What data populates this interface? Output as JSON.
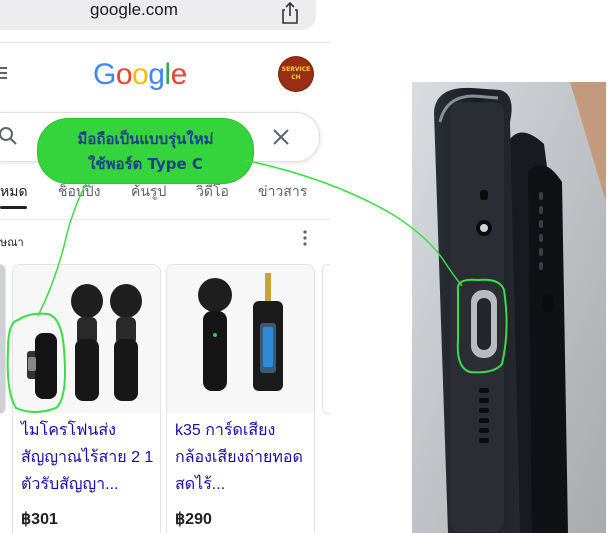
{
  "browser": {
    "url": "google.com",
    "share_icon": "share-icon"
  },
  "google": {
    "logo_letters": [
      {
        "char": "G",
        "color": "#4285F4"
      },
      {
        "char": "o",
        "color": "#EA4335"
      },
      {
        "char": "o",
        "color": "#FBBC05"
      },
      {
        "char": "g",
        "color": "#4285F4"
      },
      {
        "char": "l",
        "color": "#34A853"
      },
      {
        "char": "e",
        "color": "#EA4335"
      }
    ],
    "avatar_line1": "SERVICE",
    "avatar_line2": "CH",
    "menu_icon": "hamburger-icon",
    "search_icon": "search-icon",
    "clear_icon": "close-icon"
  },
  "tabs": [
    {
      "label": "หมด",
      "active": true
    },
    {
      "label": "ช็อปปิ้ง",
      "active": false
    },
    {
      "label": "ค้นรูป",
      "active": false
    },
    {
      "label": "วิดีโอ",
      "active": false
    },
    {
      "label": "ข่าวสาร",
      "active": false
    }
  ],
  "ads_label": "ษณา",
  "products": [
    {
      "title": "ไมโครโฟนส่งสัญญาณไร้สาย 2 1 ตัวรับสัญญา...",
      "price": "฿301"
    },
    {
      "title": "k35 การ์ดเสียงกล้องเสียงถ่ายทอดสดไร้...",
      "price": "฿290"
    }
  ],
  "callout": {
    "line1": "มือถือเป็นแบบรุ่นใหม่",
    "line2": "ใช้พอร์ต Type C",
    "color": "#35d43c",
    "text_color": "#1d3f8c"
  }
}
